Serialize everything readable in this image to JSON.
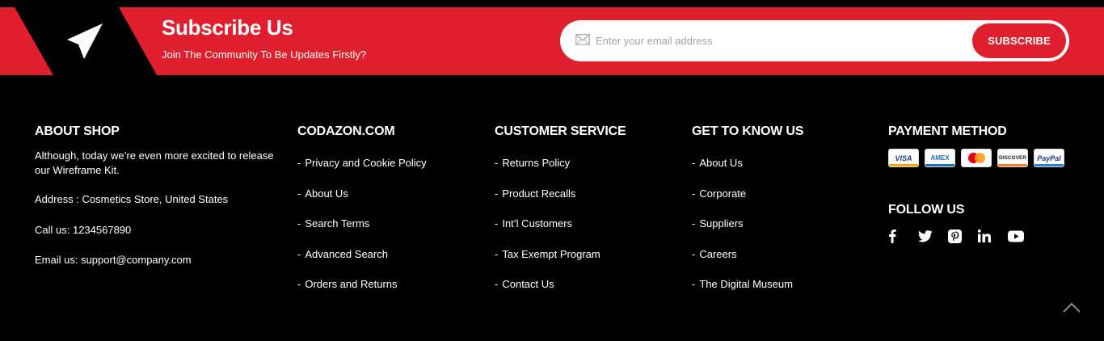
{
  "subscribe": {
    "title": "Subscribe Us",
    "tagline": "Join The Community To Be Updates Firstly?",
    "email_placeholder": "Enter your email address",
    "email_value": "",
    "button_label": "SUBSCRIBE",
    "icon": "paper-plane-icon"
  },
  "about": {
    "heading": "ABOUT SHOP",
    "description": "Although, today we’re even more excited to release our Wireframe Kit.",
    "address": "Address : Cosmetics Store, United States",
    "phone": "Call us: 1234567890",
    "email": "Email us: support@company.com"
  },
  "columns": [
    {
      "heading": "CODAZON.COM",
      "links": [
        "Privacy and Cookie Policy",
        "About Us",
        "Search Terms",
        "Advanced Search",
        "Orders and Returns"
      ]
    },
    {
      "heading": "CUSTOMER SERVICE",
      "links": [
        "Returns Policy",
        "Product Recalls",
        "Int’l Customers",
        "Tax Exempt Program",
        "Contact Us"
      ]
    },
    {
      "heading": "GET TO KNOW US",
      "links": [
        "About Us",
        "Corporate",
        "Suppliers",
        "Careers",
        "The Digital Museum"
      ]
    }
  ],
  "link_bullet": "-",
  "payment": {
    "heading": "PAYMENT METHOD",
    "cards": [
      {
        "name": "visa-card-icon",
        "text": "VISA"
      },
      {
        "name": "amex-card-icon",
        "text": "AMEX"
      },
      {
        "name": "mastercard-card-icon",
        "text": ""
      },
      {
        "name": "discover-card-icon",
        "text": "DISCOVER"
      },
      {
        "name": "paypal-card-icon",
        "text": "PayPal"
      }
    ]
  },
  "follow": {
    "heading": "FOLLOW US",
    "icons": [
      "facebook-icon",
      "twitter-icon",
      "pinterest-icon",
      "linkedin-icon",
      "youtube-icon"
    ]
  },
  "colors": {
    "brand_red": "#df1f2d",
    "background": "#000000",
    "text": "#ffffff"
  },
  "back_to_top_icon": "chevron-up-icon"
}
